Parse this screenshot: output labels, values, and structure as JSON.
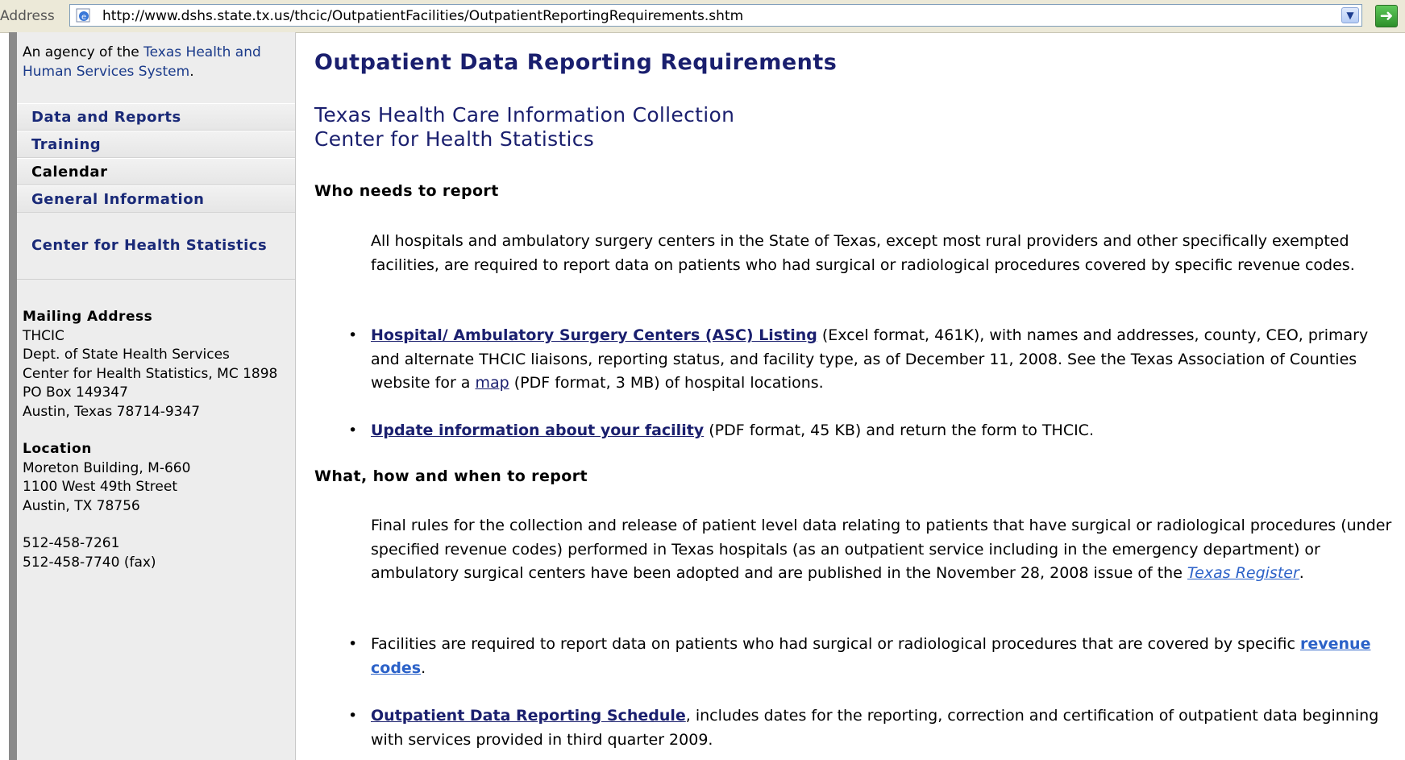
{
  "address_bar": {
    "label": "Address",
    "url": "http://www.dshs.state.tx.us/thcic/OutpatientFacilities/OutpatientReportingRequirements.shtm",
    "page_icon": "ie-page-icon",
    "dropdown_icon": "chevron-down-icon",
    "go_icon": "go-arrow-icon"
  },
  "sidebar": {
    "agency_prefix": "An agency of the",
    "agency_link": "Texas Health and Human Services System",
    "agency_suffix": ".",
    "nav": [
      {
        "label": "Data and Reports"
      },
      {
        "label": "Training"
      },
      {
        "label": "Calendar"
      },
      {
        "label": "General Information"
      }
    ],
    "center_link": "Center for Health Statistics",
    "mailing": {
      "heading": "Mailing Address",
      "lines": [
        "THCIC",
        "Dept. of State Health Services",
        "Center for Health Statistics, MC 1898",
        "PO Box 149347",
        "Austin, Texas 78714-9347"
      ]
    },
    "location": {
      "heading": "Location",
      "lines": [
        "Moreton Building, M-660",
        "1100 West 49th Street",
        "Austin, TX 78756"
      ]
    },
    "phone": "512-458-7261",
    "fax": "512-458-7740 (fax)"
  },
  "main": {
    "title": "Outpatient Data Reporting Requirements",
    "subtitle_line1": "Texas Health Care Information Collection",
    "subtitle_line2": "Center for Health Statistics",
    "who_heading": "Who needs to report",
    "who_para": "All hospitals and ambulatory surgery centers in the State of Texas, except most rural providers and other specifically exempted facilities, are required to report data on patients who had surgical or radiological procedures covered by specific revenue codes.",
    "bullet1_link": "Hospital/ Ambulatory Surgery Centers (ASC) Listing",
    "bullet1_text": " (Excel format, 461K), with names and addresses, county, CEO, primary and alternate THCIC liaisons, reporting status, and facility type, as of December 11, 2008. See the Texas Association of Counties website for a ",
    "bullet1_map": "map",
    "bullet1_tail": " (PDF format, 3 MB) of hospital locations.",
    "bullet2_link": "Update information about your facility",
    "bullet2_text": " (PDF format, 45 KB) and return the form to THCIC.",
    "what_heading": "What, how and when to report",
    "what_para": "Final rules for the collection and release of patient level data relating to patients that have surgical or radiological procedures (under specified revenue codes) performed in Texas hospitals (as an outpatient service including in the emergency department) or ambulatory surgical centers have been adopted and are published in the November 28, 2008 issue of the ",
    "what_link": "Texas Register",
    "what_tail": ".",
    "bullet3_text": "Facilities are required to report data on patients who had surgical or radiological procedures that are covered by specific ",
    "bullet3_link": "revenue codes",
    "bullet3_tail": ".",
    "bullet4_link": "Outpatient Data Reporting Schedule",
    "bullet4_text": ", includes dates for the reporting, correction and certification of outpatient data beginning with services provided in third quarter 2009."
  }
}
